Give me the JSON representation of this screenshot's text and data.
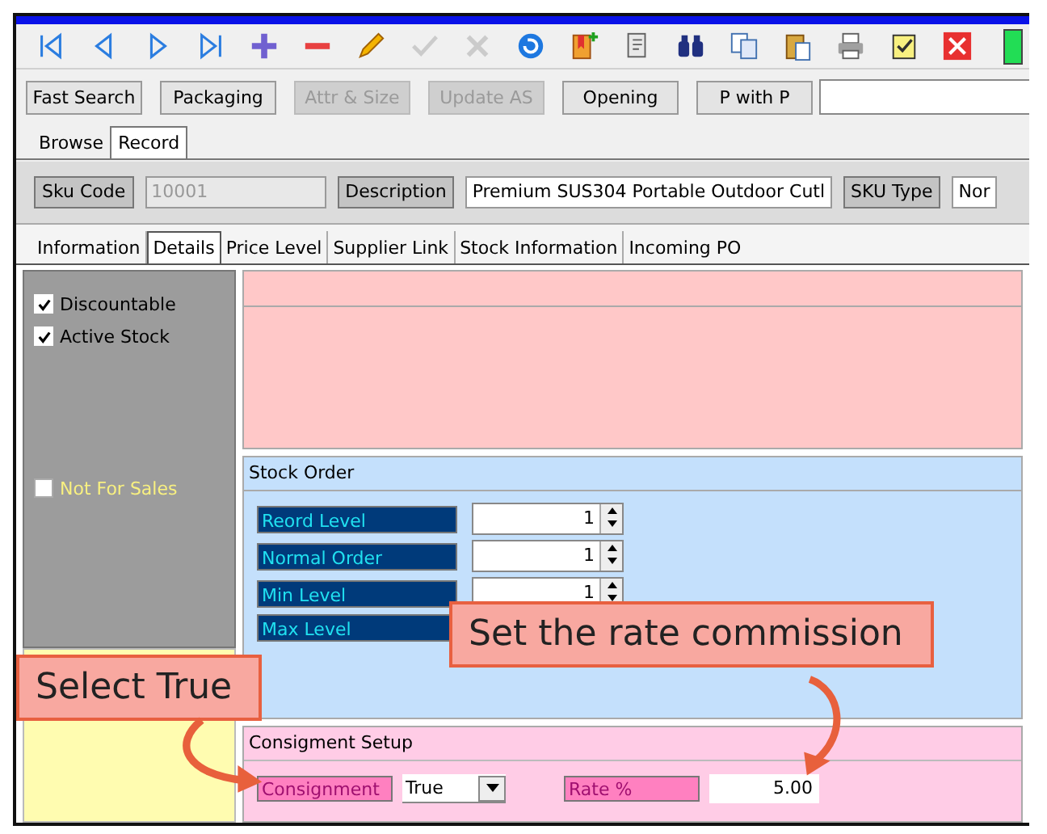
{
  "toolbar": [
    {
      "kind": "first",
      "disabled": false
    },
    {
      "kind": "prev",
      "disabled": false
    },
    {
      "kind": "next",
      "disabled": false
    },
    {
      "kind": "last",
      "disabled": false
    },
    {
      "kind": "add",
      "disabled": false
    },
    {
      "kind": "delete",
      "disabled": false
    },
    {
      "kind": "edit",
      "disabled": false
    },
    {
      "kind": "save",
      "disabled": true
    },
    {
      "kind": "cancel",
      "disabled": true
    },
    {
      "kind": "refresh",
      "disabled": false
    },
    {
      "kind": "newdoc",
      "disabled": false
    },
    {
      "kind": "doc",
      "disabled": false
    },
    {
      "kind": "find",
      "disabled": false
    },
    {
      "kind": "copy",
      "disabled": false
    },
    {
      "kind": "paste",
      "disabled": false
    },
    {
      "kind": "print",
      "disabled": false
    },
    {
      "kind": "checklist",
      "disabled": false
    },
    {
      "kind": "close",
      "disabled": false
    }
  ],
  "buttons": [
    {
      "label": "Fast Search",
      "disabled": false
    },
    {
      "label": "Packaging",
      "disabled": false
    },
    {
      "label": "Attr & Size",
      "disabled": true
    },
    {
      "label": "Update AS",
      "disabled": true
    },
    {
      "label": "Opening",
      "disabled": false
    },
    {
      "label": "P with P",
      "disabled": false
    }
  ],
  "view_tabs": [
    {
      "label": "Browse",
      "selected": false
    },
    {
      "label": "Record",
      "selected": true
    }
  ],
  "header_fields": [
    {
      "label": "Sku Code",
      "value": "10001",
      "disabled": true
    },
    {
      "label": "Description",
      "value": "Premium SUS304 Portable Outdoor Cutl",
      "disabled": false
    },
    {
      "label": "SKU Type",
      "value": "Nor",
      "disabled": false
    }
  ],
  "detail_tabs": [
    {
      "label": "Information",
      "selected": false
    },
    {
      "label": "Details",
      "selected": true
    },
    {
      "label": "Price Level",
      "selected": false
    },
    {
      "label": "Supplier Link",
      "selected": false
    },
    {
      "label": "Stock Information",
      "selected": false
    },
    {
      "label": "Incoming PO",
      "selected": false
    }
  ],
  "flags": [
    {
      "label": "Discountable",
      "checked": true
    },
    {
      "label": "Active Stock",
      "checked": true
    },
    {
      "label": "Not For Sales",
      "checked": false
    }
  ],
  "stock_order": {
    "title": "Stock Order",
    "rows": [
      {
        "label": "Reord Level",
        "value": "1"
      },
      {
        "label": "Normal Order",
        "value": "1"
      },
      {
        "label": "Min Level",
        "value": "1"
      },
      {
        "label": "Max Level"
      }
    ]
  },
  "consignment": {
    "title": "Consigment Setup",
    "label": "Consignment",
    "value": "True",
    "rate_label": "Rate %",
    "rate": "5.00"
  },
  "callouts": [
    {
      "text": "Set the rate commission"
    },
    {
      "text": "Select True"
    }
  ]
}
